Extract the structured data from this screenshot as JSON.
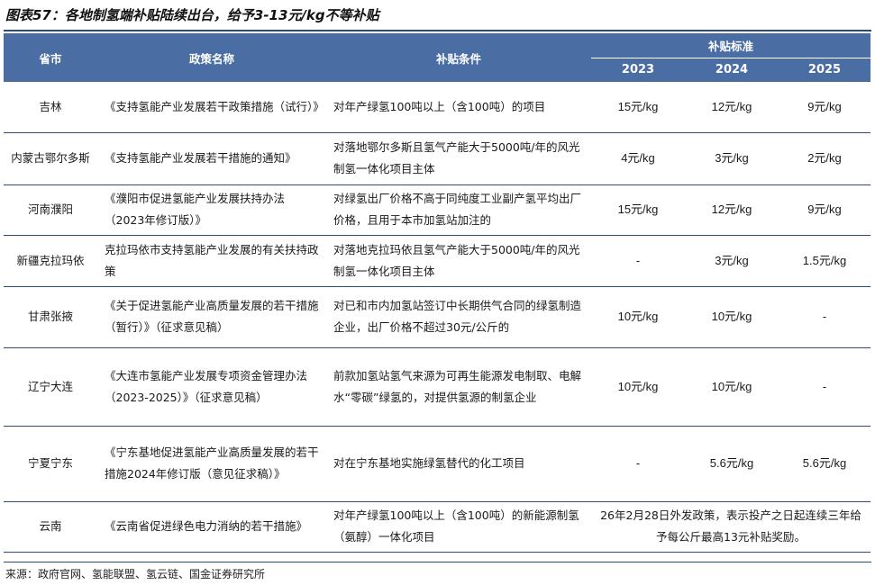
{
  "title": "图表57：各地制氢端补贴陆续出台，给予3-13元/kg不等补贴",
  "headers": {
    "province": "省市",
    "policy": "政策名称",
    "condition": "补贴条件",
    "standard": "补贴标准",
    "y2023": "2023",
    "y2024": "2024",
    "y2025": "2025"
  },
  "rows": [
    {
      "province": "吉林",
      "policy": "《支持氢能产业发展若干政策措施（试行）》",
      "condition": "对年产绿氢100吨以上（含100吨）的项目",
      "v2023": "15元/kg",
      "v2024": "12元/kg",
      "v2025": "9元/kg"
    },
    {
      "province": "内蒙古鄂尔多斯",
      "policy": "《支持氢能产业发展若干措施的通知》",
      "condition": "对落地鄂尔多斯且氢气产能大于5000吨/年的风光制氢一体化项目主体",
      "v2023": "4元/kg",
      "v2024": "3元/kg",
      "v2025": "2元/kg"
    },
    {
      "province": "河南濮阳",
      "policy": "《濮阳市促进氢能产业发展扶持办法（2023年修订版）》",
      "condition": "对绿氢出厂价格不高于同纯度工业副产氢平均出厂价格，且用于本市加氢站加注的",
      "v2023": "15元/kg",
      "v2024": "12元/kg",
      "v2025": "9元/kg"
    },
    {
      "province": "新疆克拉玛依",
      "policy": "克拉玛依市支持氢能产业发展的有关扶持政策",
      "condition": "对落地克拉玛依且氢气产能大于5000吨/年的风光制氢一体化项目主体",
      "v2023": "-",
      "v2024": "3元/kg",
      "v2025": "1.5元/kg"
    },
    {
      "province": "甘肃张掖",
      "policy": "《关于促进氢能产业高质量发展的若干措施（暂行）》（征求意见稿）",
      "condition": "对已和市内加氢站签订中长期供气合同的绿氢制造企业，出厂价格不超过30元/公斤的",
      "v2023": "10元/kg",
      "v2024": "10元/kg",
      "v2025": "-"
    },
    {
      "province": "辽宁大连",
      "policy": "《大连市氢能产业发展专项资金管理办法（2023-2025）》（征求意见稿）",
      "condition": "前款加氢站氢气来源为可再生能源发电制取、电解水“零碳”绿氢的，对提供氢源的制氢企业",
      "v2023": "10元/kg",
      "v2024": "10元/kg",
      "v2025": "-"
    },
    {
      "province": "宁夏宁东",
      "policy": "《宁东基地促进氢能产业高质量发展的若干措施2024年修订版（意见征求稿）》",
      "condition": "对在宁东基地实施绿氢替代的化工项目",
      "v2023": "-",
      "v2024": "5.6元/kg",
      "v2025": "5.6元/kg"
    },
    {
      "province": "云南",
      "policy": "《云南省促进绿色电力消纳的若干措施》",
      "condition": "对年产绿氢100吨以上（含100吨）的新能源制氢（氨醇）一体化项目",
      "merged": "26年2月28日外发政策，表示投产之日起连续三年给予每公斤最高13元补贴奖励。"
    }
  ],
  "source": "来源：政府官网、氢能联盟、氢云链、国金证券研究所"
}
